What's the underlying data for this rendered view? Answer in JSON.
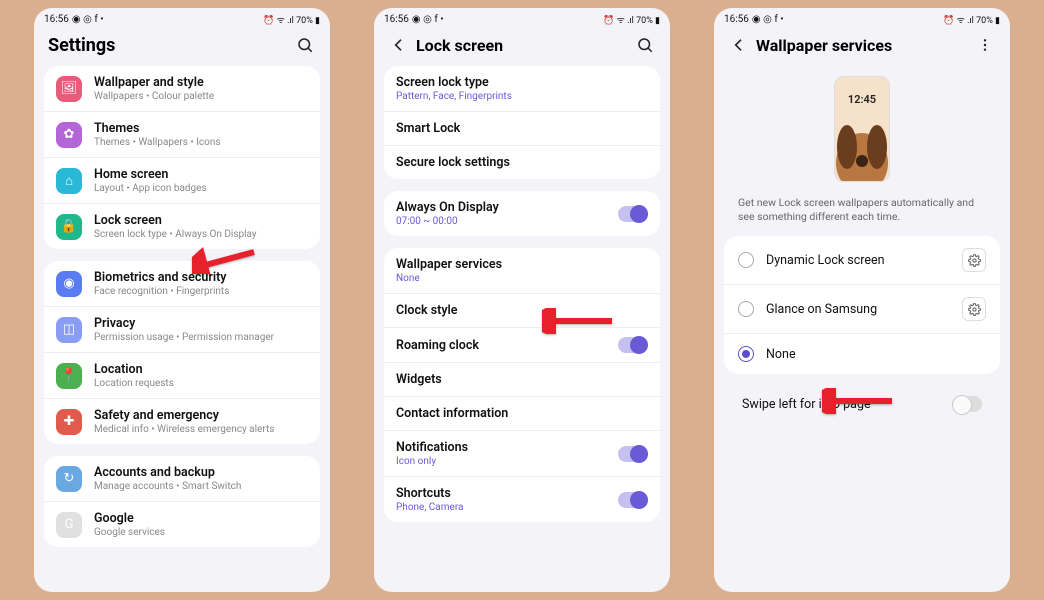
{
  "status": {
    "time": "16:56",
    "icons_left": "◉ ◎ f •",
    "icons_right": "⏰ ᯤ .ıl 70% ▮"
  },
  "screen1": {
    "title": "Settings",
    "items_group1": [
      {
        "title": "Wallpaper and style",
        "sub": "Wallpapers • Colour palette",
        "icon": "🖼",
        "color": "#e85b7a"
      },
      {
        "title": "Themes",
        "sub": "Themes • Wallpapers • Icons",
        "icon": "✿",
        "color": "#b466d9"
      },
      {
        "title": "Home screen",
        "sub": "Layout • App icon badges",
        "icon": "⌂",
        "color": "#29b8d6"
      },
      {
        "title": "Lock screen",
        "sub": "Screen lock type • Always On Display",
        "icon": "🔒",
        "color": "#1fb88a"
      }
    ],
    "items_group2": [
      {
        "title": "Biometrics and security",
        "sub": "Face recognition • Fingerprints",
        "icon": "◉",
        "color": "#5a7cf2"
      },
      {
        "title": "Privacy",
        "sub": "Permission usage • Permission manager",
        "icon": "◫",
        "color": "#8a9df5"
      },
      {
        "title": "Location",
        "sub": "Location requests",
        "icon": "📍",
        "color": "#4caf50"
      },
      {
        "title": "Safety and emergency",
        "sub": "Medical info • Wireless emergency alerts",
        "icon": "✚",
        "color": "#e25a4b"
      }
    ],
    "items_group3": [
      {
        "title": "Accounts and backup",
        "sub": "Manage accounts • Smart Switch",
        "icon": "↻",
        "color": "#69a8e0"
      },
      {
        "title": "Google",
        "sub": "Google services",
        "icon": "G",
        "color": "#e0e0e0"
      }
    ]
  },
  "screen2": {
    "title": "Lock screen",
    "group1": [
      {
        "title": "Screen lock type",
        "sub": "Pattern, Face, Fingerprints",
        "subAccent": true
      },
      {
        "title": "Smart Lock"
      },
      {
        "title": "Secure lock settings"
      }
    ],
    "group2": [
      {
        "title": "Always On Display",
        "sub": "07:00 ~ 00:00",
        "subAccent": true,
        "toggle": "on"
      }
    ],
    "group3": [
      {
        "title": "Wallpaper services",
        "sub": "None",
        "subAccent": true
      },
      {
        "title": "Clock style"
      },
      {
        "title": "Roaming clock",
        "toggle": "on"
      },
      {
        "title": "Widgets"
      },
      {
        "title": "Contact information"
      },
      {
        "title": "Notifications",
        "sub": "Icon only",
        "subAccent": true,
        "toggle": "on"
      },
      {
        "title": "Shortcuts",
        "sub": "Phone, Camera",
        "subAccent": true,
        "toggle": "on"
      }
    ]
  },
  "screen3": {
    "title": "Wallpaper services",
    "preview_time": "12:45",
    "description": "Get new Lock screen wallpapers automatically and see something different each time.",
    "options": [
      {
        "label": "Dynamic Lock screen",
        "selected": false,
        "gear": true
      },
      {
        "label": "Glance on Samsung",
        "selected": false,
        "gear": true
      },
      {
        "label": "None",
        "selected": true,
        "gear": false
      }
    ],
    "swipe_label": "Swipe left for info page"
  }
}
